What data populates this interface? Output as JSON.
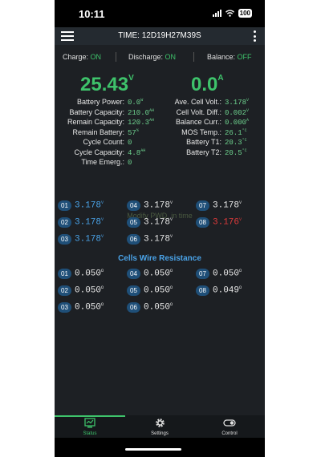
{
  "status_bar": {
    "time": "10:11",
    "battery": "100"
  },
  "header": {
    "title": "TIME: 12D19H27M39S"
  },
  "flags": [
    {
      "label": "Charge:",
      "value": "ON"
    },
    {
      "label": "Discharge:",
      "value": "ON"
    },
    {
      "label": "Balance:",
      "value": "OFF"
    }
  ],
  "main": {
    "voltage": "25.43",
    "voltage_unit": "V",
    "current": "0.0",
    "current_unit": "A"
  },
  "left_stats": [
    {
      "label": "Battery Power:",
      "value": "0.0",
      "unit": "W"
    },
    {
      "label": "Battery Capacity:",
      "value": "210.0",
      "unit": "AH"
    },
    {
      "label": "Remain Capacity:",
      "value": "120.3",
      "unit": "AH"
    },
    {
      "label": "Remain Battery:",
      "value": "57",
      "unit": "%"
    },
    {
      "label": "Cycle Count:",
      "value": "0",
      "unit": ""
    },
    {
      "label": "Cycle Capacity:",
      "value": "4.8",
      "unit": "AH"
    },
    {
      "label": "Time Emerg.:",
      "value": "0",
      "unit": ""
    }
  ],
  "right_stats": [
    {
      "label": "Ave. Cell Volt.:",
      "value": "3.178",
      "unit": "V"
    },
    {
      "label": "Cell Volt. Diff.:",
      "value": "0.002",
      "unit": "V"
    },
    {
      "label": "Balance Curr.:",
      "value": "0.000",
      "unit": "A"
    },
    {
      "label": "MOS Temp.:",
      "value": "26.1",
      "unit": "°C"
    },
    {
      "label": "Battery T1:",
      "value": "20.3",
      "unit": "°C"
    },
    {
      "label": "Battery T2:",
      "value": "20.5",
      "unit": "°C"
    }
  ],
  "hint": "Modify PWD. in time",
  "cell_voltages": [
    {
      "id": "01",
      "value": "3.178",
      "unit": "V",
      "color": "#4aa3e8"
    },
    {
      "id": "02",
      "value": "3.178",
      "unit": "V",
      "color": "#4aa3e8"
    },
    {
      "id": "03",
      "value": "3.178",
      "unit": "V",
      "color": "#4aa3e8"
    },
    {
      "id": "04",
      "value": "3.178",
      "unit": "V",
      "color": "#e8e8e8"
    },
    {
      "id": "05",
      "value": "3.178",
      "unit": "V",
      "color": "#e8e8e8"
    },
    {
      "id": "06",
      "value": "3.178",
      "unit": "V",
      "color": "#e8e8e8"
    },
    {
      "id": "07",
      "value": "3.178",
      "unit": "V",
      "color": "#e8e8e8"
    },
    {
      "id": "08",
      "value": "3.176",
      "unit": "V",
      "color": "#e03b3b"
    }
  ],
  "resistance_title": "Cells Wire Resistance",
  "cell_resistances": [
    {
      "id": "01",
      "value": "0.050",
      "unit": "Ω"
    },
    {
      "id": "02",
      "value": "0.050",
      "unit": "Ω"
    },
    {
      "id": "03",
      "value": "0.050",
      "unit": "Ω"
    },
    {
      "id": "04",
      "value": "0.050",
      "unit": "Ω"
    },
    {
      "id": "05",
      "value": "0.050",
      "unit": "Ω"
    },
    {
      "id": "06",
      "value": "0.050",
      "unit": "Ω"
    },
    {
      "id": "07",
      "value": "0.050",
      "unit": "Ω"
    },
    {
      "id": "08",
      "value": "0.049",
      "unit": "Ω"
    }
  ],
  "nav": [
    {
      "label": "Status",
      "icon": "status-icon",
      "active": true
    },
    {
      "label": "Settings",
      "icon": "gear-icon",
      "active": false
    },
    {
      "label": "Control",
      "icon": "toggle-icon",
      "active": false
    }
  ],
  "colors": {
    "accent_green": "#3ec36b",
    "cell_blue": "#4aa3e8",
    "cell_low_red": "#e03b3b",
    "badge_blue": "#1f4f78"
  }
}
